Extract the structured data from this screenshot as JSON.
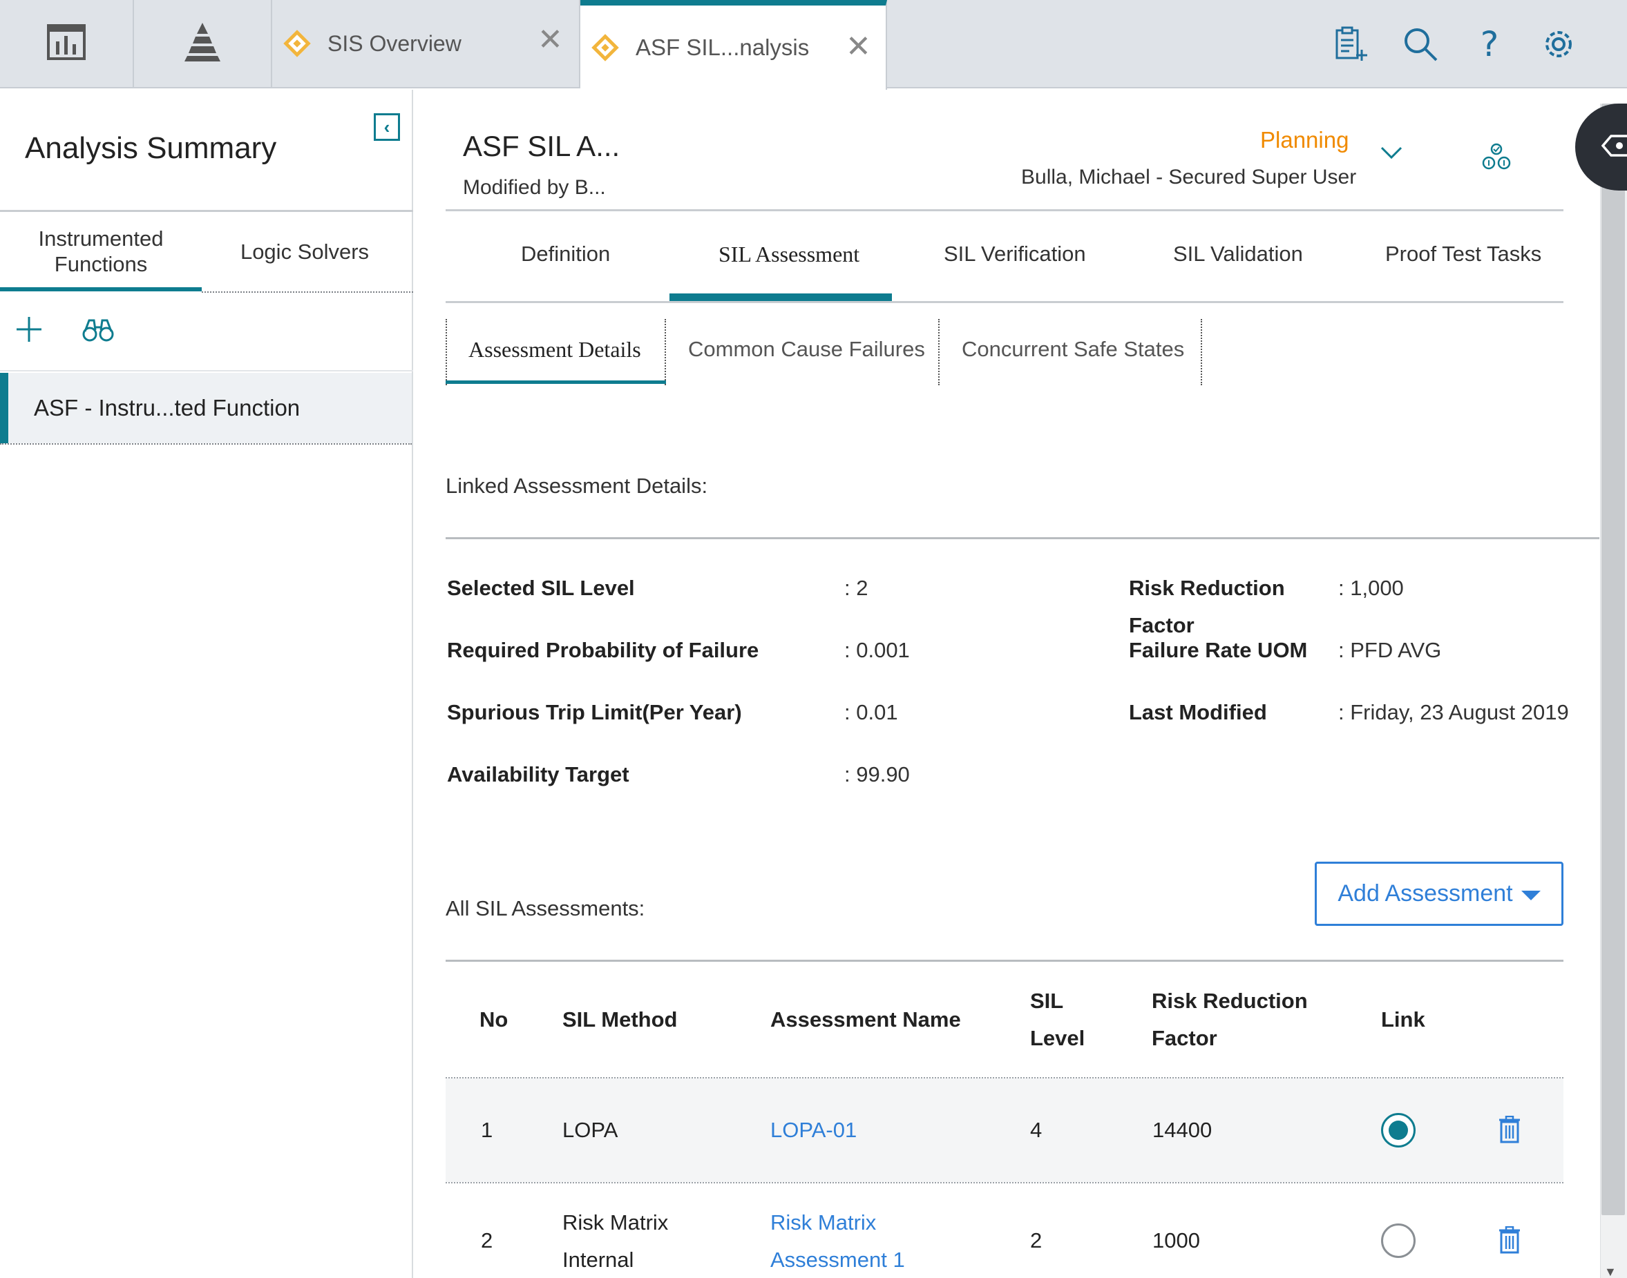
{
  "topbar": {
    "tabs": [
      {
        "label": "SIS Overview",
        "icon": "diamond-icon"
      },
      {
        "label": "ASF SIL...nalysis",
        "icon": "diamond-icon"
      }
    ],
    "tools": [
      "add-to-list-icon",
      "search-icon",
      "help-icon",
      "gear-icon"
    ]
  },
  "left": {
    "title": "Analysis Summary",
    "tabs": [
      {
        "label": "Instrumented Functions"
      },
      {
        "label": "Logic Solvers"
      }
    ],
    "items": [
      {
        "label": "ASF - Instru...ted Function"
      }
    ]
  },
  "record": {
    "title": "ASF SIL A...",
    "modified": "Modified by B...",
    "state": "Planning",
    "user": "Bulla, Michael - Secured Super User"
  },
  "main_tabs": [
    "Definition",
    "SIL Assessment",
    "SIL Verification",
    "SIL Validation",
    "Proof Test Tasks"
  ],
  "sub_tabs": [
    "Assessment Details",
    "Common Cause Failures",
    "Concurrent Safe States"
  ],
  "linked": {
    "title": "Linked Assessment Details:",
    "fields": [
      {
        "label": "Selected SIL Level",
        "value": ": 2"
      },
      {
        "label": "Required Probability of Failure",
        "value": ": 0.001"
      },
      {
        "label": "Spurious Trip Limit(Per Year)",
        "value": ": 0.01"
      },
      {
        "label": "Availability Target",
        "value": ": 99.90"
      },
      {
        "label_line1": "Risk Reduction",
        "label_line2": "Factor",
        "value": ": 1,000"
      },
      {
        "label": "Failure Rate UOM",
        "value": ": PFD AVG"
      },
      {
        "label": "Last Modified",
        "value": ": Friday, 23 August 2019"
      }
    ]
  },
  "assessments": {
    "title": "All SIL Assessments:",
    "add_label": "Add Assessment",
    "columns": [
      "No",
      "SIL Method",
      "Assessment Name",
      "SIL",
      "Level",
      "Risk Reduction",
      "Factor",
      "Link"
    ],
    "rows": [
      {
        "no": "1",
        "method": "LOPA",
        "method2": "",
        "name": "LOPA-01",
        "name2": "",
        "sil": "4",
        "rrf": "14400",
        "linked": true
      },
      {
        "no": "2",
        "method": "Risk Matrix",
        "method2": "Internal",
        "name": "Risk Matrix",
        "name2": "Assessment 1",
        "sil": "2",
        "rrf": "1000",
        "linked": false
      }
    ]
  },
  "colors": {
    "accent": "#0e7c8f",
    "link": "#2f7fd8",
    "state": "#f08a00",
    "tab_diamond": "#f2b53c"
  }
}
